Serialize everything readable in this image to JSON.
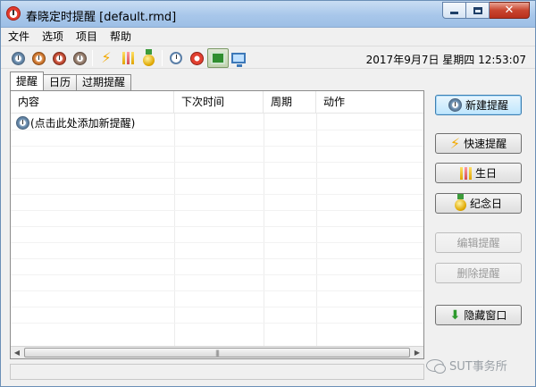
{
  "window": {
    "title": "春晓定时提醒 [default.rmd]"
  },
  "menu": {
    "items": [
      "文件",
      "选项",
      "项目",
      "帮助"
    ]
  },
  "toolbar": {
    "icons": [
      "clock-blue-icon",
      "clock-orange-icon",
      "clock-red-icon",
      "clock-gray-icon",
      "lightning-icon",
      "candles-icon",
      "medal-icon",
      "stopwatch-icon",
      "alarm-clock-icon",
      "green-window-icon",
      "monitor-icon"
    ],
    "active_icon": "green-window-icon"
  },
  "datetime": "2017年9月7日 星期四 12:53:07",
  "tabs": [
    {
      "label": "提醒",
      "active": true
    },
    {
      "label": "日历",
      "active": false
    },
    {
      "label": "过期提醒",
      "active": false
    }
  ],
  "list": {
    "columns": [
      "内容",
      "下次时间",
      "周期",
      "动作"
    ],
    "rows": [
      {
        "content": "(点击此处添加新提醒)",
        "next_time": "",
        "period": "",
        "action": ""
      }
    ]
  },
  "side_buttons": {
    "new_reminder": "新建提醒",
    "quick_reminder": "快速提醒",
    "birthday": "生日",
    "anniversary": "纪念日",
    "edit_reminder": "编辑提醒",
    "delete_reminder": "删除提醒",
    "hide_window": "隐藏窗口"
  },
  "watermark": "SUT事务所",
  "colors": {
    "titlebar": "#a8c7ea",
    "close_button": "#c9452f",
    "accent_blue": "#3c7fb1",
    "disabled_text": "#9a9a9a"
  }
}
